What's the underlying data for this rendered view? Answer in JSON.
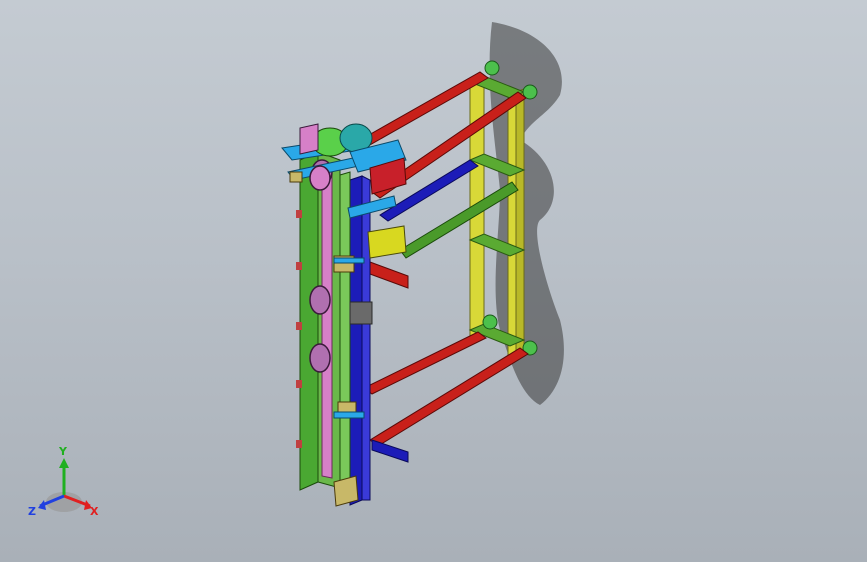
{
  "viewport": {
    "background_top": "#c4cbd2",
    "background_bottom": "#a9b0b8"
  },
  "model": {
    "description_icon": "cad-assembly-icon",
    "colors": {
      "frame_red": "#c8201a",
      "frame_yellow": "#d8d838",
      "frame_green": "#3a9a2a",
      "column_green": "#5aa83a",
      "rail_blue": "#1c1cb8",
      "slider_pink": "#d680c8",
      "motor_teal": "#2aa8a8",
      "accent_cyan": "#2aa8e8",
      "shadow": "#3a3a3a"
    }
  },
  "triad": {
    "icon": "coordinate-triad-icon",
    "y_label": "Y",
    "x_label": "X",
    "z_label": "Z",
    "colors": {
      "x": "#e02020",
      "y": "#20b020",
      "z": "#2040e0"
    }
  }
}
